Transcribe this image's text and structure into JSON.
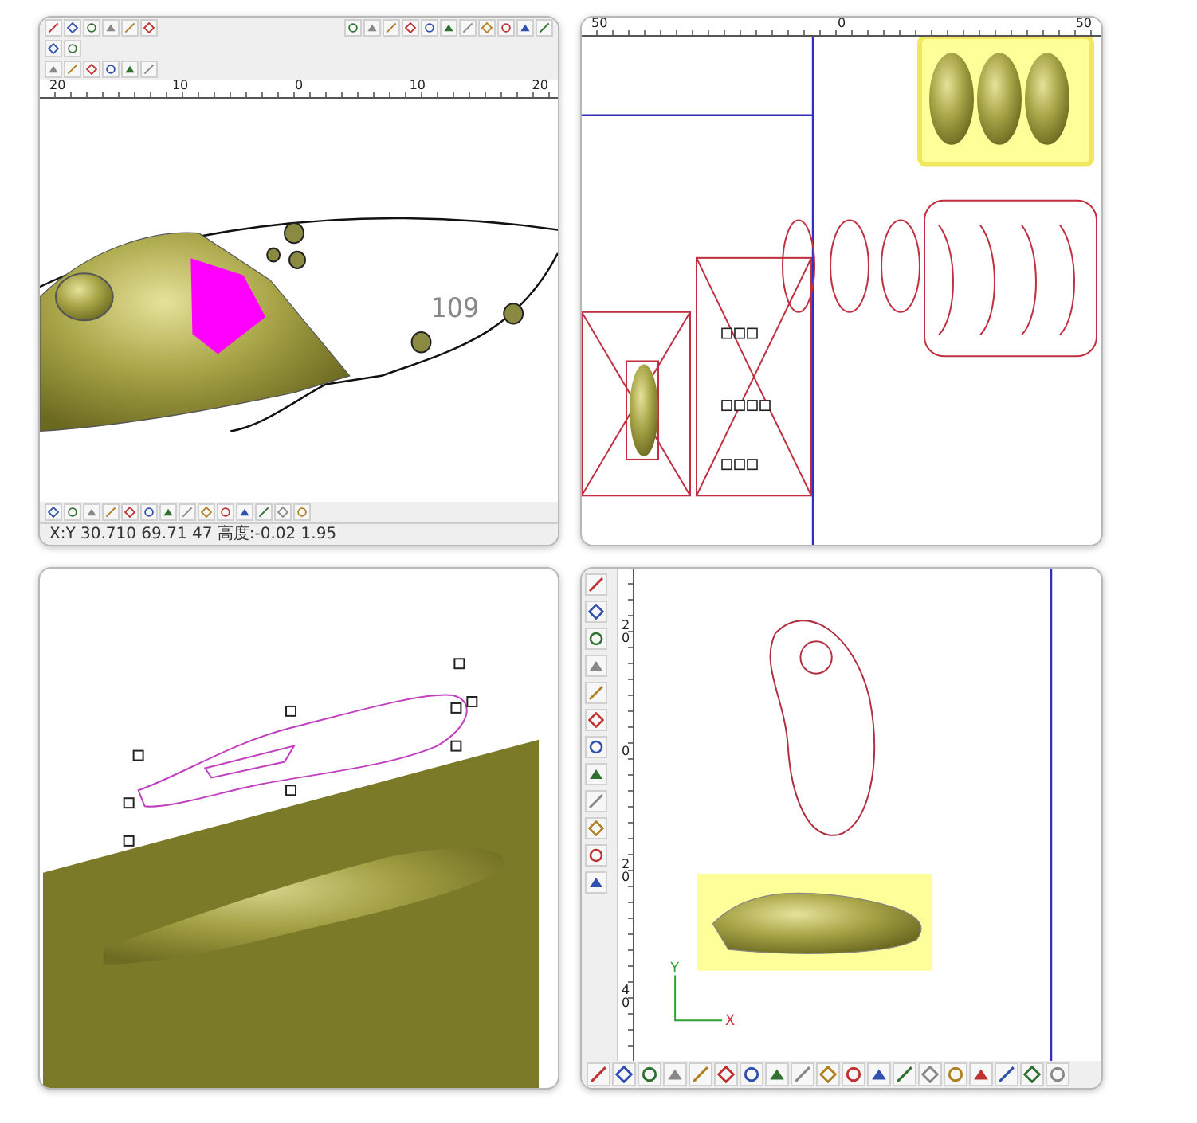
{
  "panels": [
    {
      "kind": "lure-edit",
      "ruler_ticks": [
        "20",
        "10",
        "0",
        "10",
        "20"
      ],
      "label": "109",
      "status": "X:Y 30.710 69.71 47 高度:-0.02 1.95"
    },
    {
      "kind": "layout",
      "ruler_ticks": [
        "50",
        "0",
        "50"
      ]
    },
    {
      "kind": "relief"
    },
    {
      "kind": "outline",
      "ruler_ticks": [
        "20",
        "0",
        "20",
        "40"
      ],
      "axis_y": "Y",
      "axis_x": "X"
    }
  ]
}
